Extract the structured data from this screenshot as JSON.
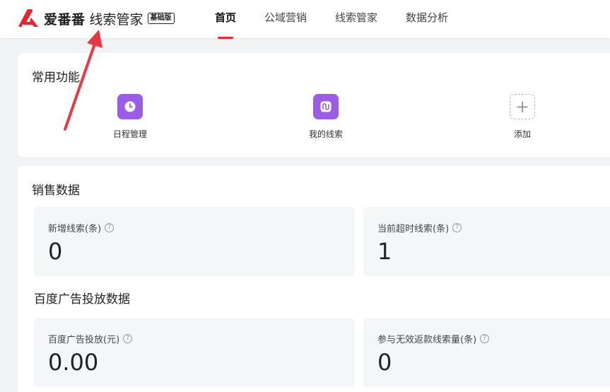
{
  "header": {
    "brand": "爱番番",
    "product": "线索管家",
    "edition": "基础版",
    "nav": [
      {
        "label": "首页",
        "active": true
      },
      {
        "label": "公域营销",
        "active": false
      },
      {
        "label": "线索管家",
        "active": false
      },
      {
        "label": "数据分析",
        "active": false
      }
    ]
  },
  "common": {
    "title": "常用功能",
    "items": [
      {
        "label": "日程管理",
        "icon": "clock-icon"
      },
      {
        "label": "我的线索",
        "icon": "lead-icon"
      },
      {
        "label": "添加",
        "icon": "plus-icon"
      }
    ]
  },
  "sales": {
    "title": "销售数据",
    "new_leads": {
      "label": "新增线索(条)",
      "value": "0"
    },
    "overdue_leads": {
      "label": "当前超时线索(条)",
      "value": "1"
    }
  },
  "baidu": {
    "title": "百度广告投放数据",
    "spend": {
      "label": "百度广告投放(元)",
      "value": "0.00"
    },
    "refund_leads": {
      "label": "参与无效返款线索量(条)",
      "value": "0"
    }
  },
  "colors": {
    "accent": "#e8262e",
    "icon_purple": "#9b5de5",
    "annotation_arrow": "#e8393f"
  }
}
